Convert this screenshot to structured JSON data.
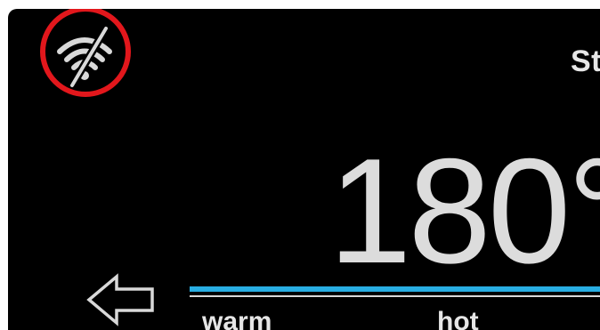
{
  "header": {
    "status_label": "St",
    "wifi_icon": "wifi-off-icon",
    "highlight_color": "#e2171c"
  },
  "main": {
    "temperature": "180°"
  },
  "controls": {
    "back_icon": "arrow-left-icon",
    "slider_color": "#29aee3",
    "levels": [
      "warm",
      "hot"
    ]
  }
}
